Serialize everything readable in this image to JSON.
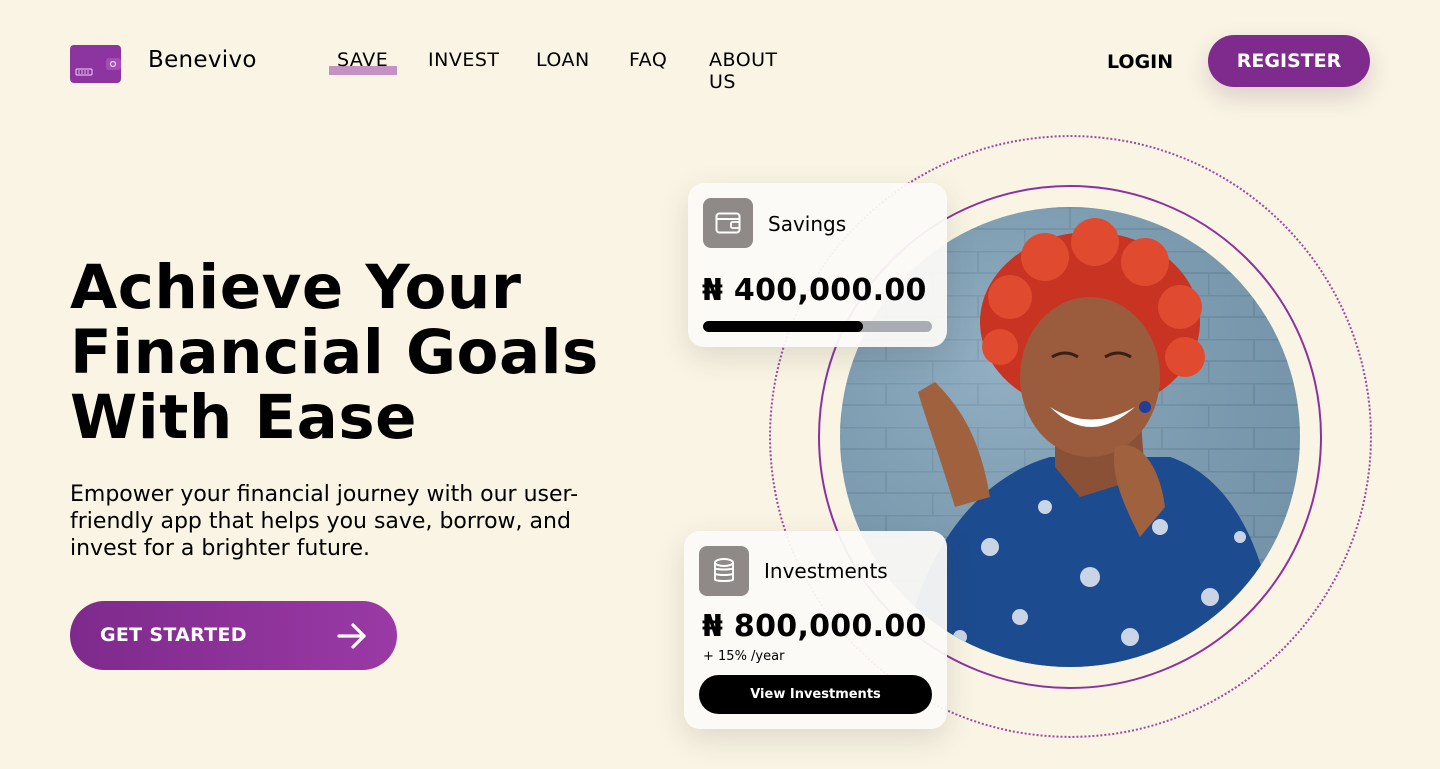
{
  "brand": {
    "name": "Benevivo",
    "logo_icon": "wallet-icon",
    "color": "#8c35a0"
  },
  "nav": {
    "items": [
      {
        "label": "SAVE",
        "active": true
      },
      {
        "label": "INVEST",
        "active": false
      },
      {
        "label": "LOAN",
        "active": false
      },
      {
        "label": "FAQ",
        "active": false
      },
      {
        "label": "ABOUT US",
        "active": false
      }
    ],
    "active_underline_color": "#c491c2"
  },
  "auth": {
    "login_label": "LOGIN",
    "register_label": "REGISTER"
  },
  "hero": {
    "title_lines": [
      "Achieve Your",
      "Financial Goals",
      "With Ease"
    ],
    "subtitle_lines": [
      "Empower your financial journey with our user-",
      "friendly app that helps you save, borrow, and",
      "invest for a brighter future."
    ],
    "cta_label": "GET STARTED",
    "cta_icon": "arrow-right-icon"
  },
  "savings_card": {
    "icon": "wallet-icon",
    "title": "Savings",
    "amount": "₦ 400,000.00",
    "progress": 0.7
  },
  "investments_card": {
    "icon": "coins-stack-icon",
    "title": "Investments",
    "amount": "₦ 800,000.00",
    "rate": "+ 15% /year",
    "button_label": "View Investments"
  },
  "colors": {
    "background": "#f9f4e3",
    "primary": "#7f2b8d",
    "ring": "#8c32a0"
  }
}
